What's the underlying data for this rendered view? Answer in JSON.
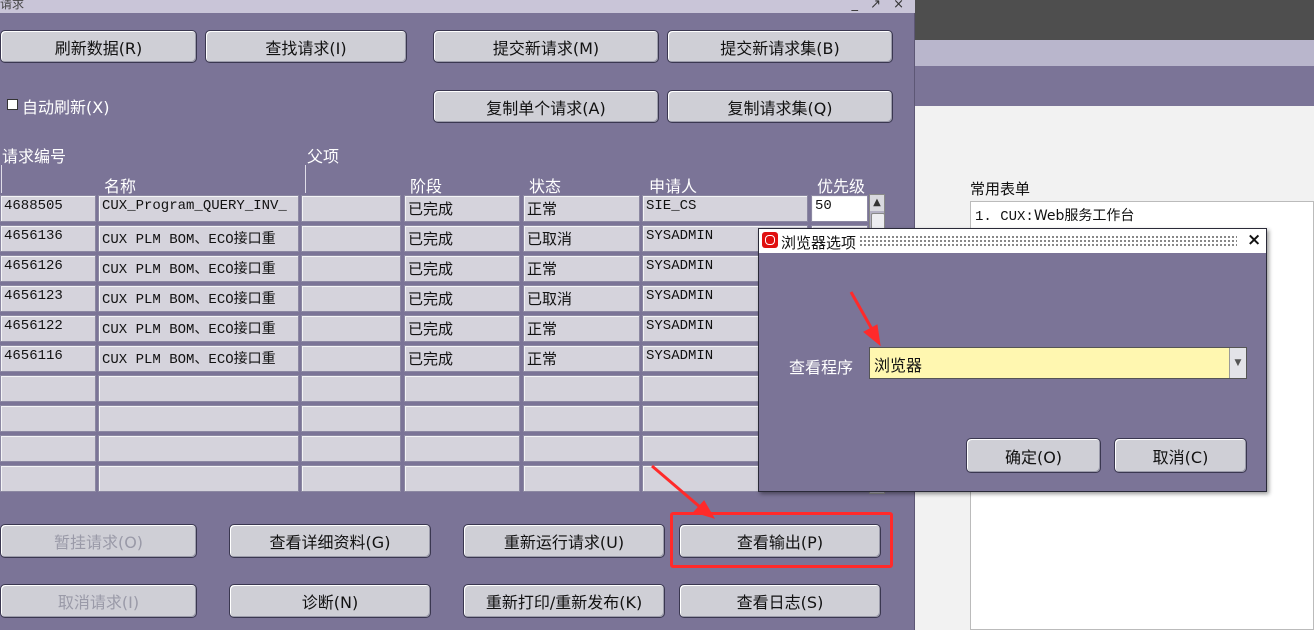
{
  "window": {
    "title": "请求",
    "title_icons": "_ ↗ ×"
  },
  "buttons": {
    "refresh": "刷新数据(R)",
    "find": "查找请求(I)",
    "submit_new": "提交新请求(M)",
    "submit_new_set": "提交新请求集(B)",
    "copy_single": "复制单个请求(A)",
    "copy_set": "复制请求集(Q)",
    "hold": "暂挂请求(O)",
    "view_details": "查看详细资料(G)",
    "rerun": "重新运行请求(U)",
    "view_output": "查看输出(P)",
    "cancel_request": "取消请求(I)",
    "diagnostics": "诊断(N)",
    "reprint": "重新打印/重新发布(K)",
    "view_log": "查看日志(S)"
  },
  "auto_refresh": {
    "label": "自动刷新(X)",
    "checked": false
  },
  "table": {
    "header_request_id": "请求编号",
    "header_parent": "父项",
    "header_name": "名称",
    "header_phase": "阶段",
    "header_status": "状态",
    "header_requestor": "申请人",
    "header_priority": "优先级",
    "rows": [
      {
        "id": "4688505",
        "name": "CUX_Program_QUERY_INV_",
        "parent": "",
        "phase": "已完成",
        "status": "正常",
        "requestor": "SIE_CS",
        "priority": "50"
      },
      {
        "id": "4656136",
        "name": "CUX PLM BOM、ECO接口重",
        "parent": "",
        "phase": "已完成",
        "status": "已取消",
        "requestor": "SYSADMIN",
        "priority": ""
      },
      {
        "id": "4656126",
        "name": "CUX PLM BOM、ECO接口重",
        "parent": "",
        "phase": "已完成",
        "status": "正常",
        "requestor": "SYSADMIN",
        "priority": ""
      },
      {
        "id": "4656123",
        "name": "CUX PLM BOM、ECO接口重",
        "parent": "",
        "phase": "已完成",
        "status": "已取消",
        "requestor": "SYSADMIN",
        "priority": ""
      },
      {
        "id": "4656122",
        "name": "CUX PLM BOM、ECO接口重",
        "parent": "",
        "phase": "已完成",
        "status": "正常",
        "requestor": "SYSADMIN",
        "priority": ""
      },
      {
        "id": "4656116",
        "name": "CUX PLM BOM、ECO接口重",
        "parent": "",
        "phase": "已完成",
        "status": "正常",
        "requestor": "SYSADMIN",
        "priority": ""
      }
    ]
  },
  "common_forms": {
    "title": "常用表单",
    "item1_num": "1. CUX:",
    "item1_label": "Web服务工作台"
  },
  "dialog": {
    "title": "浏览器选项",
    "viewer_label": "查看程序",
    "viewer_value": "浏览器",
    "ok": "确定(O)",
    "cancel": "取消(C)"
  },
  "colors": {
    "window_bg": "#7b7497",
    "highlight": "#ff2a2a",
    "field_bg": "#fff7b0"
  }
}
